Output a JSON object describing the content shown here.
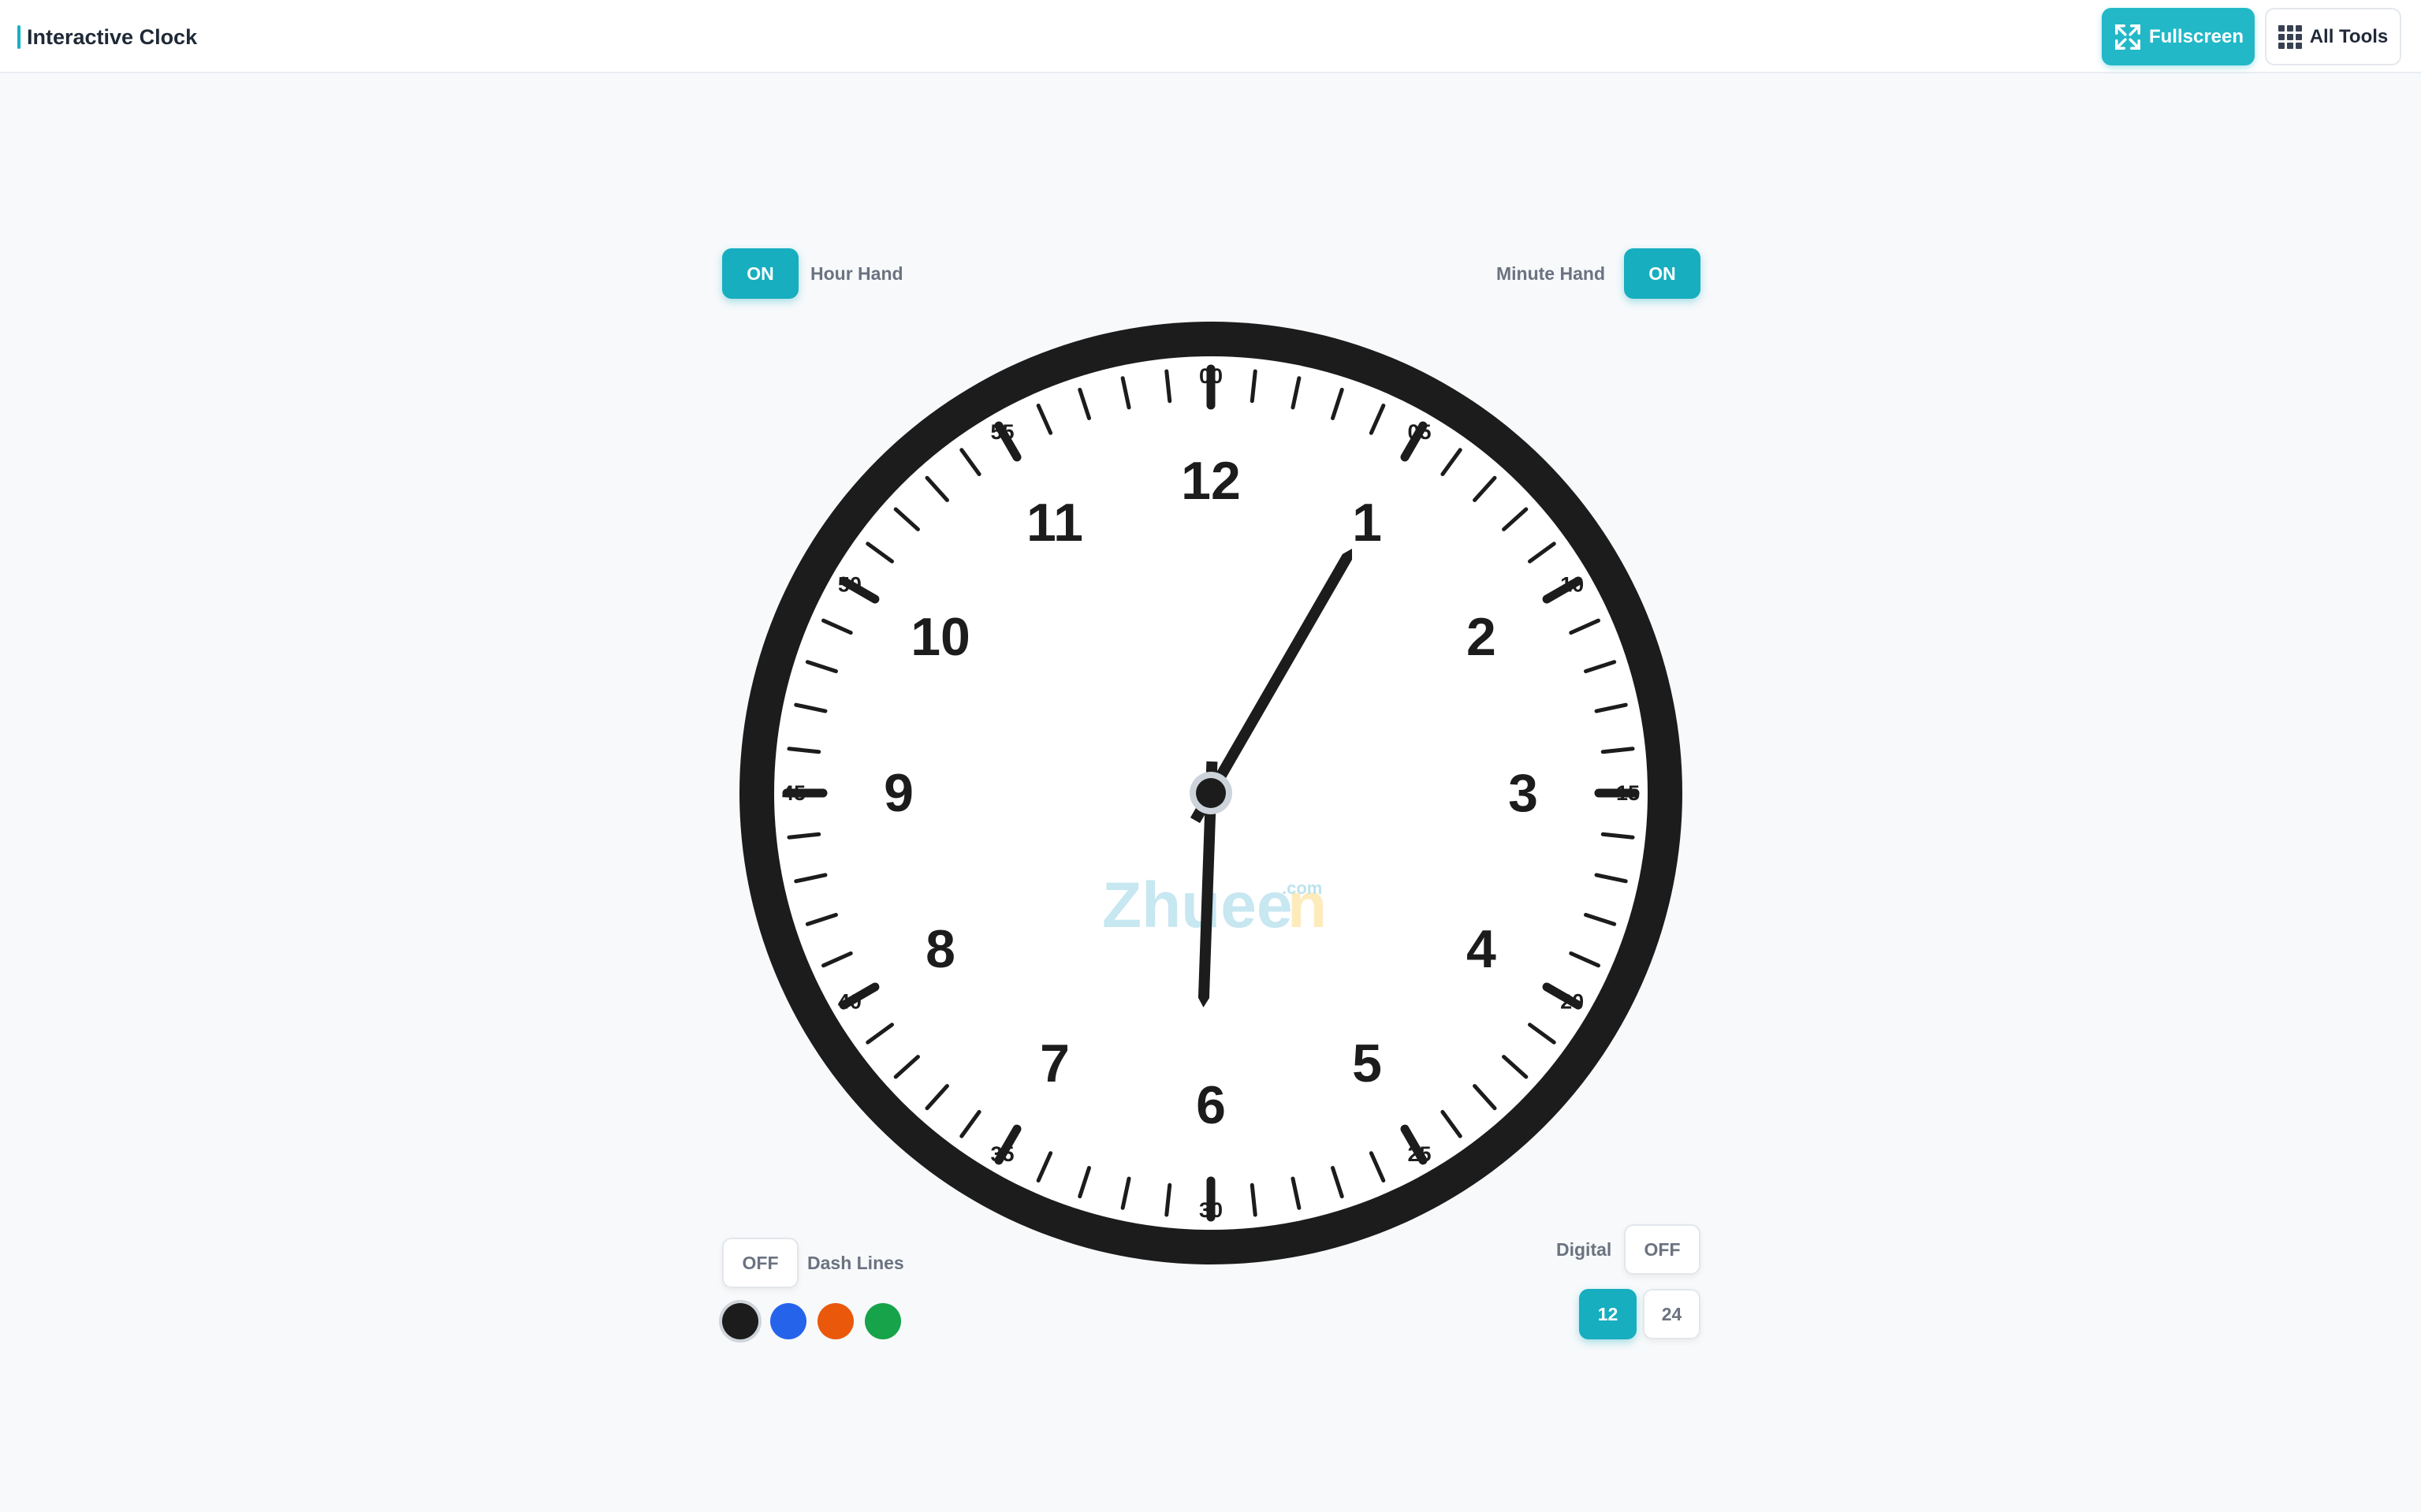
{
  "app": {
    "title": "Interactive Clock"
  },
  "header": {
    "fullscreen_label": "Fullscreen",
    "all_tools_label": "All Tools",
    "accent": "#22b8c8"
  },
  "controls": {
    "hour_hand": {
      "label": "Hour Hand",
      "state": "ON"
    },
    "minute_hand": {
      "label": "Minute Hand",
      "state": "ON"
    },
    "dash_lines": {
      "label": "Dash Lines",
      "state": "OFF"
    },
    "digital": {
      "label": "Digital",
      "state": "OFF"
    },
    "format_12": "12",
    "format_24": "24",
    "selected_format": "12",
    "colors": [
      {
        "name": "black",
        "hex": "#1c1c1c",
        "selected": true
      },
      {
        "name": "blue",
        "hex": "#2563eb",
        "selected": false
      },
      {
        "name": "orange",
        "hex": "#ea580c",
        "selected": false
      },
      {
        "name": "green",
        "hex": "#16a34a",
        "selected": false
      }
    ]
  },
  "clock": {
    "hour_numbers": [
      "12",
      "1",
      "2",
      "3",
      "4",
      "5",
      "6",
      "7",
      "8",
      "9",
      "10",
      "11"
    ],
    "minute_labels": [
      "00",
      "05",
      "10",
      "15",
      "20",
      "25",
      "30",
      "35",
      "40",
      "45",
      "50",
      "55"
    ],
    "watermark": "Zhuee",
    "watermark_last": "n",
    "watermark_suffix": ".com",
    "hour_hand_angle_deg": 182,
    "minute_hand_angle_deg": 30,
    "face_color": "#ffffff",
    "rim_color": "#1c1c1c"
  }
}
